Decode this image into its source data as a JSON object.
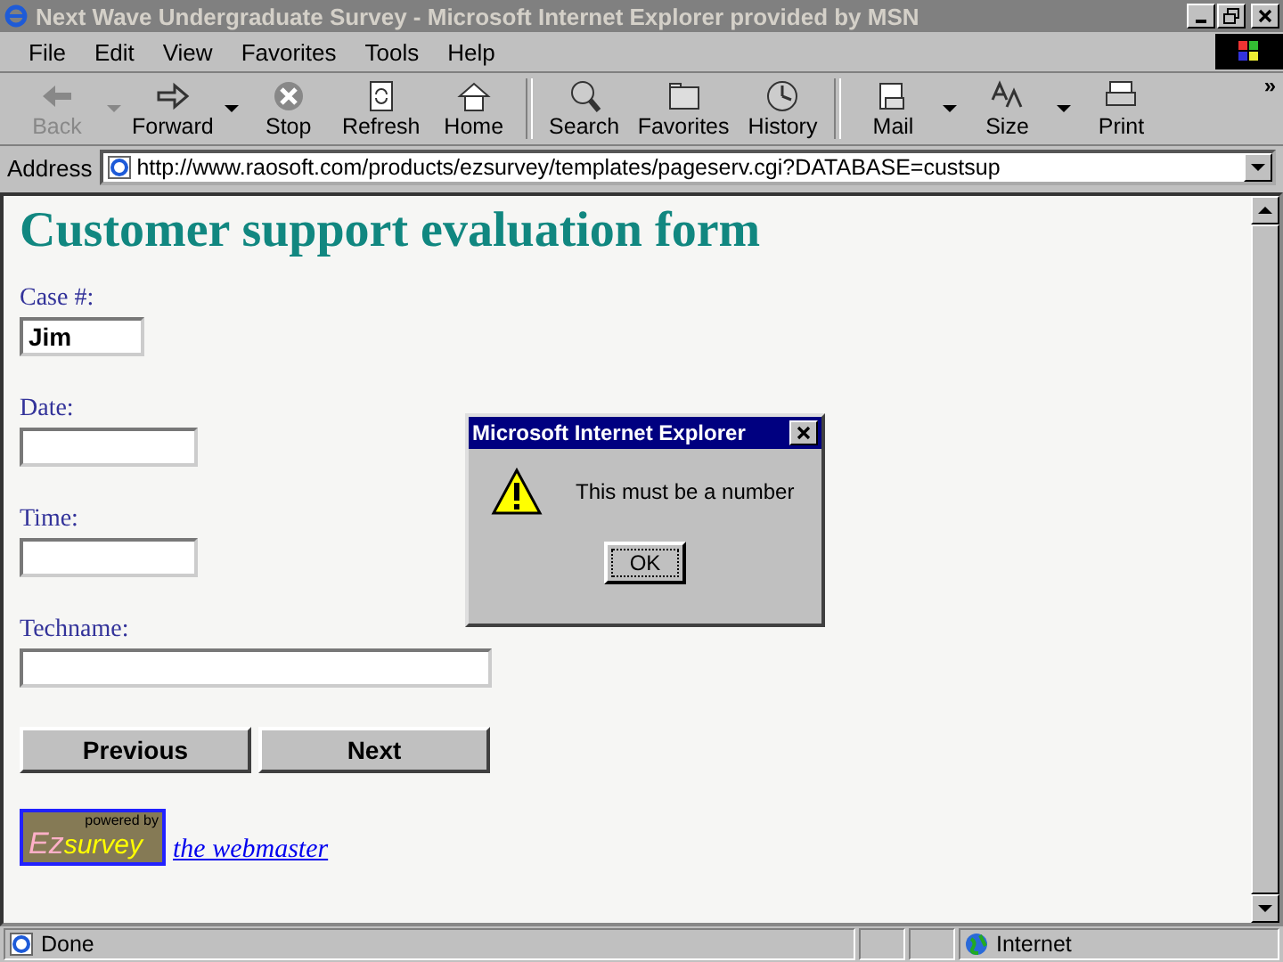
{
  "window": {
    "title": "Next Wave Undergraduate Survey - Microsoft Internet Explorer provided by MSN"
  },
  "menu": [
    {
      "label": "File"
    },
    {
      "label": "Edit"
    },
    {
      "label": "View"
    },
    {
      "label": "Favorites"
    },
    {
      "label": "Tools"
    },
    {
      "label": "Help"
    }
  ],
  "toolbar_more": "»",
  "toolbar": [
    {
      "label": "Back",
      "disabled": true,
      "dropdown": true
    },
    {
      "label": "Forward",
      "disabled": false,
      "dropdown": true
    },
    {
      "label": "Stop",
      "disabled": false,
      "dropdown": false
    },
    {
      "label": "Refresh",
      "disabled": false,
      "dropdown": false
    },
    {
      "label": "Home",
      "disabled": false,
      "dropdown": false
    },
    {
      "label": "Search",
      "disabled": false,
      "dropdown": false
    },
    {
      "label": "Favorites",
      "disabled": false,
      "dropdown": false
    },
    {
      "label": "History",
      "disabled": false,
      "dropdown": false
    },
    {
      "label": "Mail",
      "disabled": false,
      "dropdown": true
    },
    {
      "label": "Size",
      "disabled": false,
      "dropdown": true
    },
    {
      "label": "Print",
      "disabled": false,
      "dropdown": false
    }
  ],
  "address": {
    "label": "Address",
    "url": "http://www.raosoft.com/products/ezsurvey/templates/pageserv.cgi?DATABASE=custsup"
  },
  "page": {
    "title": "Customer support evaluation form",
    "fields": [
      {
        "label": "Case #:",
        "value": "Jim"
      },
      {
        "label": "Date:"
      },
      {
        "label": "Time:"
      },
      {
        "label": "Techname:"
      }
    ],
    "buttons": [
      "Previous",
      "Next"
    ],
    "logo": {
      "top": "powered by",
      "left": "Ez",
      "right": "survey"
    },
    "link": "the webmaster"
  },
  "dialog": {
    "title": "Microsoft Internet Explorer",
    "message": "This must be a number",
    "button": "OK"
  },
  "status_bar": {
    "text": "Done",
    "zone": "Internet"
  }
}
